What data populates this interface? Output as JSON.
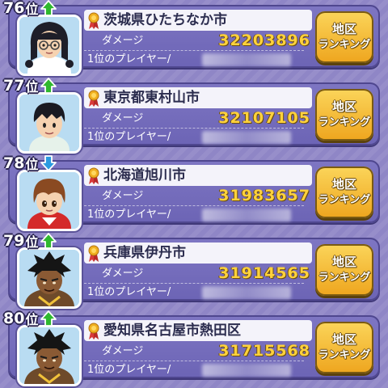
{
  "labels": {
    "damage": "ダメージ",
    "top_player": "1位のプレイヤー/",
    "rank_suffix": "位",
    "button_line1": "地区",
    "button_line2": "ランキング"
  },
  "colors": {
    "up": "#2fb82f",
    "down": "#2a9be0",
    "score": "#ffd23c",
    "button": "#f6bf35"
  },
  "entries": [
    {
      "rank": "76",
      "trend": "up",
      "trend_icon": "up-arrow-icon",
      "city": "茨城県ひたちなか市",
      "damage": "32203896",
      "avatar": "girl-with-glasses"
    },
    {
      "rank": "77",
      "trend": "up",
      "trend_icon": "up-arrow-icon",
      "city": "東京都東村山市",
      "damage": "32107105",
      "avatar": "boy-black-hair"
    },
    {
      "rank": "78",
      "trend": "down",
      "trend_icon": "down-arrow-icon",
      "city": "北海道旭川市",
      "damage": "31983657",
      "avatar": "boy-brown-hair"
    },
    {
      "rank": "79",
      "trend": "up",
      "trend_icon": "up-arrow-icon",
      "city": "兵庫県伊丹市",
      "damage": "31914565",
      "avatar": "spiky-dark-character"
    },
    {
      "rank": "80",
      "trend": "up",
      "trend_icon": "up-arrow-icon",
      "city": "愛知県名古屋市熱田区",
      "damage": "31715568",
      "avatar": "spiky-dark-character"
    }
  ]
}
